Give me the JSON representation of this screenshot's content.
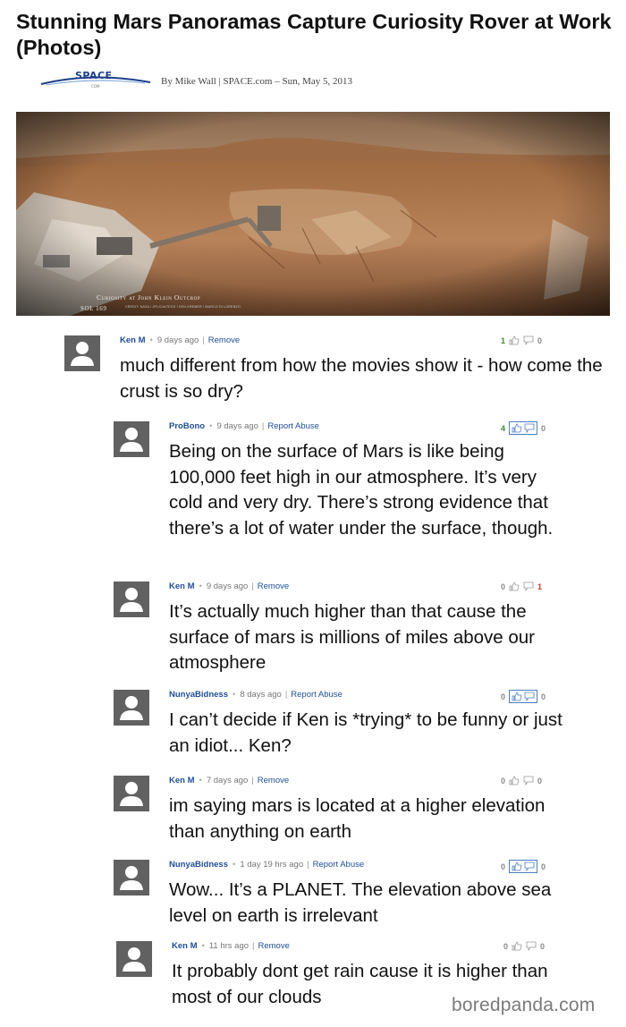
{
  "article": {
    "title": "Stunning Mars Panoramas Capture Curiosity Rover at Work (Photos)",
    "byline": "By Mike Wall | SPACE.com – Sun, May 5, 2013",
    "logo_word": "SPACE",
    "logo_sub": "COM",
    "caption_title": "Curiosity at John Klein Outcrop",
    "caption_sol": "SOL 169",
    "caption_credit": "CREDIT: NASA / JPL/CALTECH / KEN KREMER / MARCO DI LORENZO"
  },
  "comments": [
    {
      "author": "Ken M",
      "time": "9 days ago",
      "action": "Remove",
      "up": "1",
      "down": "0",
      "up_boxed": false,
      "down_red": false,
      "text": "much different from how the movies show it - how come the crust is so dry?"
    },
    {
      "author": "ProBono",
      "time": "9 days ago",
      "action": "Report Abuse",
      "up": "4",
      "down": "0",
      "up_boxed": true,
      "down_red": false,
      "text": "Being on the surface of Mars is like being 100,000 feet high in our atmosphere. It’s very cold and very dry. There’s strong evidence that there’s a lot of water under the surface, though."
    },
    {
      "author": "Ken M",
      "time": "9 days ago",
      "action": "Remove",
      "up": "0",
      "down": "1",
      "up_boxed": false,
      "down_red": true,
      "text": "It’s actually much higher than that cause the surface of mars is millions of miles above our atmosphere"
    },
    {
      "author": "NunyaBidness",
      "time": "8 days ago",
      "action": "Report Abuse",
      "up": "0",
      "down": "0",
      "up_boxed": true,
      "down_red": false,
      "text": "I can’t decide if Ken is *trying* to be funny or just an idiot... Ken?"
    },
    {
      "author": "Ken M",
      "time": "7 days ago",
      "action": "Remove",
      "up": "0",
      "down": "0",
      "up_boxed": false,
      "down_red": false,
      "text": "im saying mars is located at a higher elevation than anything on earth"
    },
    {
      "author": "NunyaBidness",
      "time": "1 day 19 hrs ago",
      "action": "Report Abuse",
      "up": "0",
      "down": "0",
      "up_boxed": true,
      "down_red": false,
      "text": "Wow... It’s a PLANET. The elevation above sea level on earth is irrelevant"
    },
    {
      "author": "Ken M",
      "time": "11 hrs ago",
      "action": "Remove",
      "up": "0",
      "down": "0",
      "up_boxed": false,
      "down_red": false,
      "text": "It probably dont get rain cause it is higher than most of our clouds"
    }
  ],
  "watermark": "boredpanda.com",
  "icons": {
    "avatar": "user-silhouette-icon",
    "thumbs_up": "thumbs-up-icon",
    "comment": "speech-bubble-icon"
  },
  "colors": {
    "link": "#1f4e99",
    "up_vote": "#3d8a2a",
    "down_vote_active": "#c0392b",
    "avatar_bg": "#616161"
  }
}
